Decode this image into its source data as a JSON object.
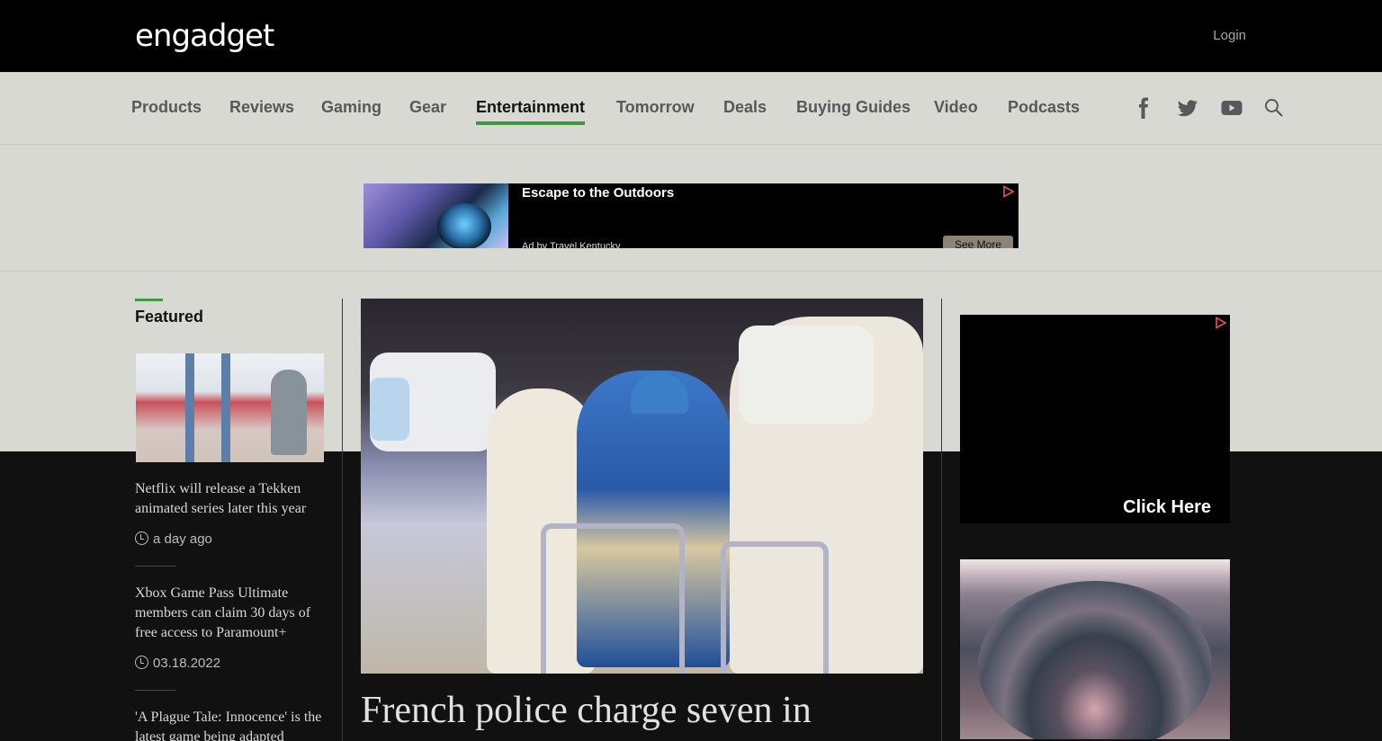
{
  "header": {
    "logo": "engadget",
    "login_label": "Login"
  },
  "nav": {
    "items": [
      {
        "label": "Products"
      },
      {
        "label": "Reviews"
      },
      {
        "label": "Gaming"
      },
      {
        "label": "Gear"
      },
      {
        "label": "Entertainment",
        "active": true
      },
      {
        "label": "Tomorrow"
      },
      {
        "label": "Deals"
      },
      {
        "label": "Buying Guides"
      },
      {
        "label": "Video"
      },
      {
        "label": "Podcasts"
      }
    ],
    "social_icons": [
      "facebook-icon",
      "twitter-icon",
      "youtube-icon",
      "search-icon"
    ],
    "accent_color": "#3f9a3f"
  },
  "top_ad": {
    "title": "Escape to the Outdoors",
    "sponsor": "Ad by Travel Kentucky",
    "cta": "See More"
  },
  "featured": {
    "label": "Featured",
    "stories": [
      {
        "title": "Netflix will release a Tekken animated series later this year",
        "time": "a day ago"
      },
      {
        "title": "Xbox Game Pass Ultimate members can claim 30 days of free access to Paramount+",
        "time": "03.18.2022"
      },
      {
        "title": "'A Plague Tale: Innocence' is the latest game being adapted",
        "time": ""
      }
    ]
  },
  "main_story": {
    "headline": "French police charge seven in"
  },
  "right_ad": {
    "cta": "Click Here"
  }
}
